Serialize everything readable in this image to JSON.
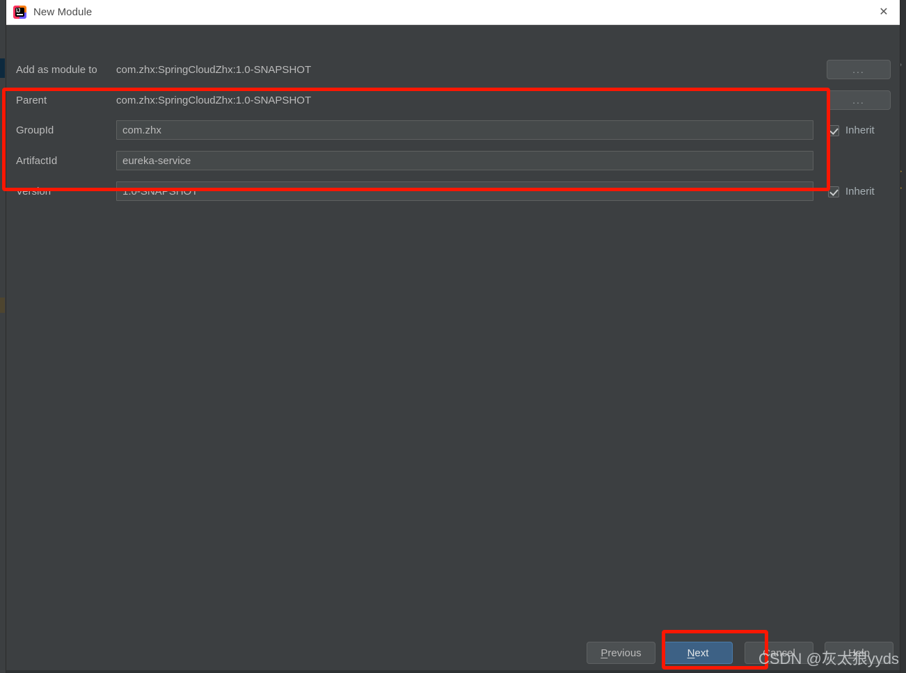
{
  "window": {
    "title": "New Module",
    "app_icon": "intellij-idea-icon",
    "close_icon": "close-icon"
  },
  "form": {
    "add_as_module_to": {
      "label": "Add as module to",
      "value": "com.zhx:SpringCloudZhx:1.0-SNAPSHOT",
      "browse_label": "..."
    },
    "parent": {
      "label": "Parent",
      "value": "com.zhx:SpringCloudZhx:1.0-SNAPSHOT",
      "browse_label": "..."
    },
    "group_id": {
      "label": "GroupId",
      "value": "com.zhx",
      "inherit_label": "Inherit",
      "inherit_checked": "true"
    },
    "artifact_id": {
      "label": "ArtifactId",
      "value": "eureka-service"
    },
    "version": {
      "label": "Version",
      "value": "1.0-SNAPSHOT",
      "inherit_label": "Inherit",
      "inherit_checked": "true"
    }
  },
  "footer": {
    "previous": "Previous",
    "next": "Next",
    "cancel": "Cancel",
    "help": "Help"
  },
  "watermark": {
    "text": "CSDN @灰太狼yyds"
  },
  "annotations": {
    "accent_color": "#fb1703",
    "primary_button_color": "#3d6185"
  }
}
